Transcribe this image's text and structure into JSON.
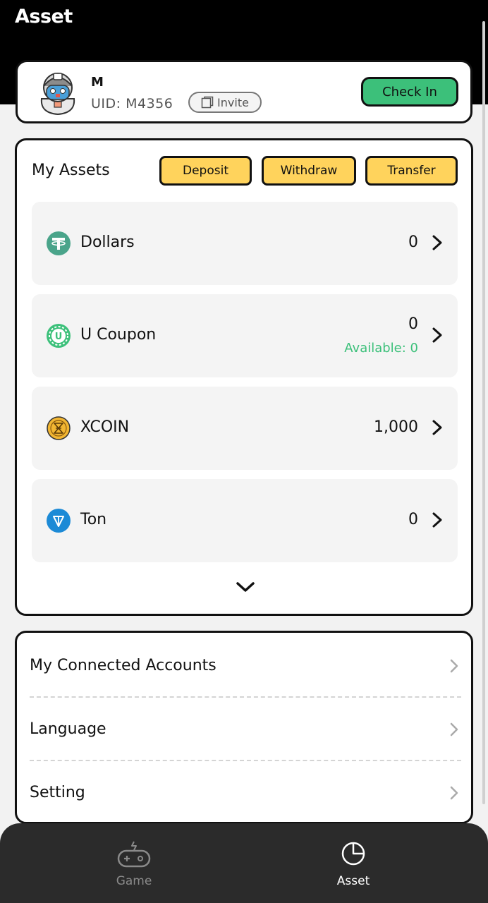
{
  "header": {
    "title": "Asset"
  },
  "profile": {
    "name": "M",
    "uid": "UID: M4356",
    "invite_label": "Invite",
    "checkin_label": "Check In"
  },
  "assets": {
    "title": "My Assets",
    "actions": {
      "deposit": "Deposit",
      "withdraw": "Withdraw",
      "transfer": "Transfer"
    },
    "rows": [
      {
        "name": "Dollars",
        "value": "0",
        "icon": "tether-icon",
        "color": "#4aa48a"
      },
      {
        "name": "U Coupon",
        "value": "0",
        "sub": "Available: 0",
        "icon": "u-coupon-icon",
        "color": "#3cc07a"
      },
      {
        "name": "XCOIN",
        "value": "1,000",
        "icon": "xcoin-icon",
        "color": "#f2b632"
      },
      {
        "name": "Ton",
        "value": "0",
        "icon": "ton-icon",
        "color": "#1c8ad6"
      }
    ]
  },
  "menu": {
    "items": [
      {
        "label": "My Connected Accounts"
      },
      {
        "label": "Language"
      },
      {
        "label": "Setting"
      }
    ]
  },
  "nav": {
    "game": "Game",
    "asset": "Asset"
  },
  "colors": {
    "accent_green": "#3cc07a",
    "button_yellow": "#ffd35c",
    "nav_bg": "#2b2b2b"
  }
}
